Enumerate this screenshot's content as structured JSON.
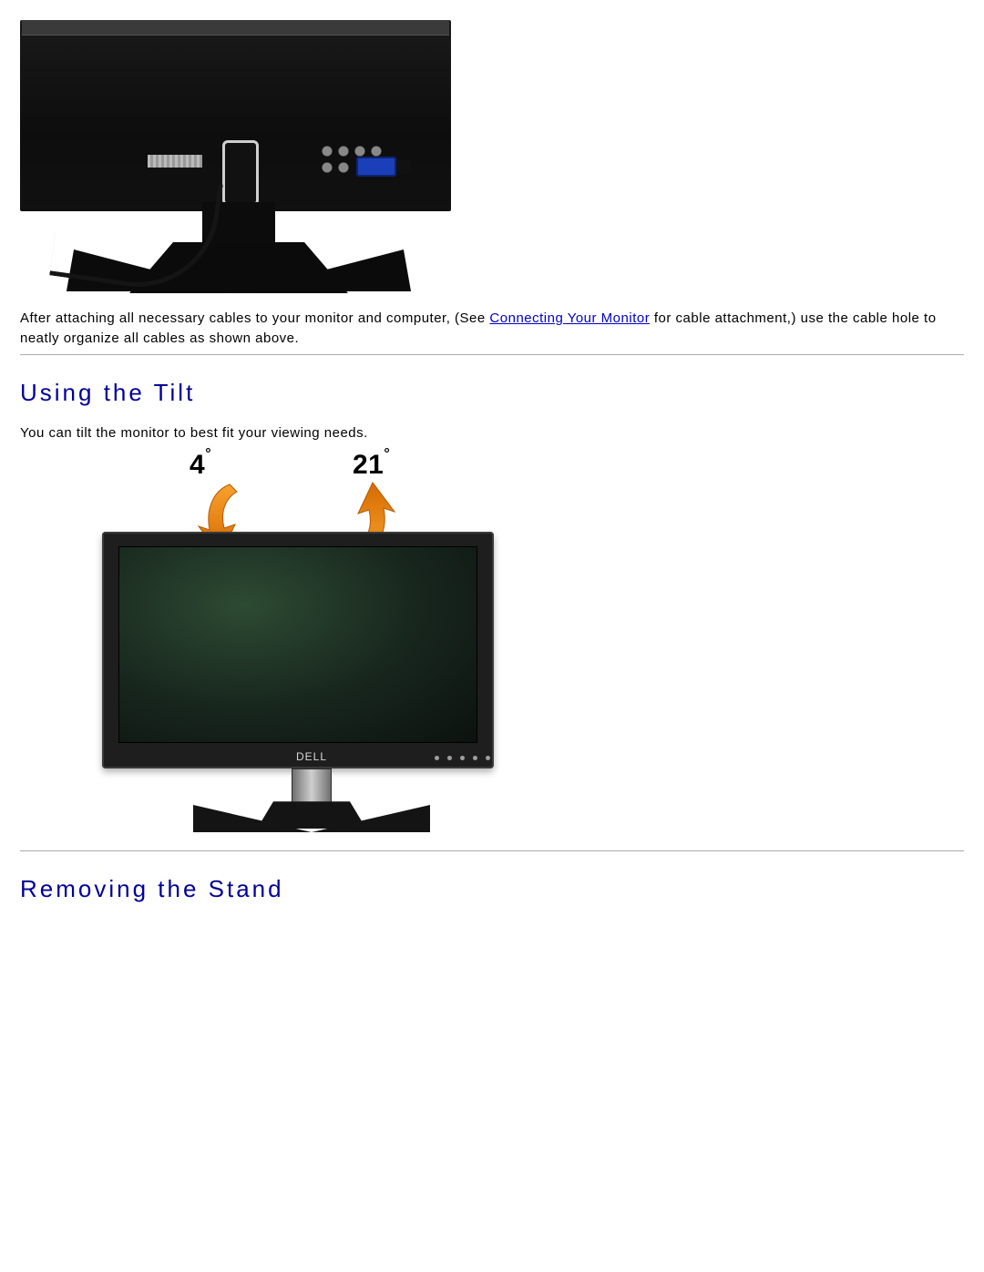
{
  "figure1": {
    "alt": "Back of monitor showing cables routed through cable-management hole in stand"
  },
  "caption": {
    "pre_link": "After attaching all necessary cables to your monitor and computer, (See ",
    "link_text": "Connecting Your Monitor",
    "post_link": " for cable attachment,) use the cable hole to neatly organize all cables as shown above."
  },
  "section_tilt": {
    "heading": "Using the Tilt",
    "body": "You can tilt the monitor to best fit your viewing needs.",
    "angle_forward": "4",
    "angle_back": "21",
    "degree_symbol": "°",
    "brand": "DELL"
  },
  "section_remove": {
    "heading": "Removing the Stand"
  }
}
